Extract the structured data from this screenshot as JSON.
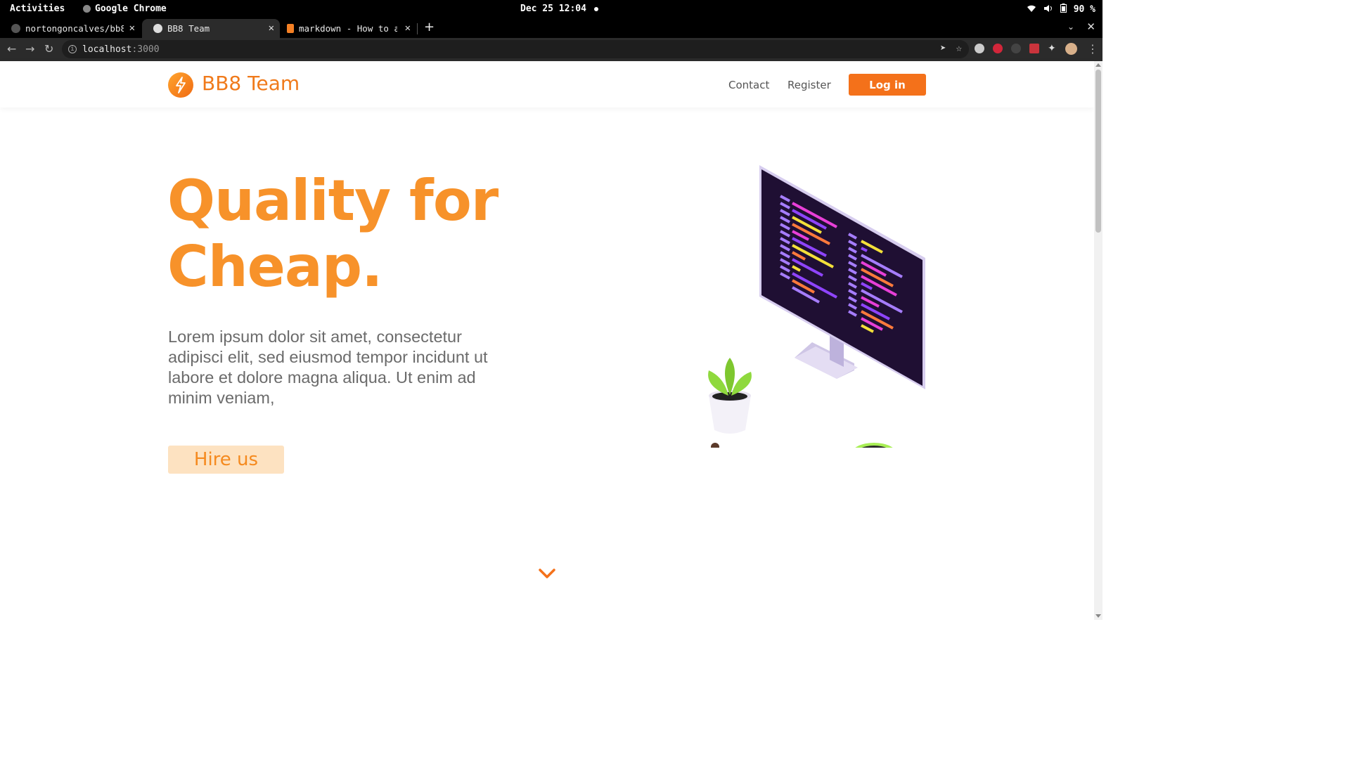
{
  "system": {
    "activities": "Activities",
    "app_name": "Google Chrome",
    "clock": "Dec 25 12:04",
    "battery": "90 %"
  },
  "browser": {
    "tabs": [
      {
        "title": "nortongoncalves/bb8",
        "icon": "github-icon",
        "active": false
      },
      {
        "title": "BB8 Team",
        "icon": "globe-icon",
        "active": true
      },
      {
        "title": "markdown - How to a",
        "icon": "stackoverflow-icon",
        "active": false
      }
    ],
    "url_host": "localhost",
    "url_port": ":3000"
  },
  "site": {
    "brand": "BB8 Team",
    "nav": {
      "contact": "Contact",
      "register": "Register",
      "login": "Log in"
    },
    "hero": {
      "title_line1": "Quality for",
      "title_line2": "Cheap.",
      "text": "Lorem ipsum dolor sit amet, consectetur adipisci elit, sed eiusmod tempor incidunt ut labore et dolore magna aliqua. Ut enim ad minim veniam,",
      "cta": "Hire us"
    },
    "colors": {
      "accent": "#f4711a",
      "title": "#f7922a",
      "cta_bg": "#fde2c1"
    }
  }
}
